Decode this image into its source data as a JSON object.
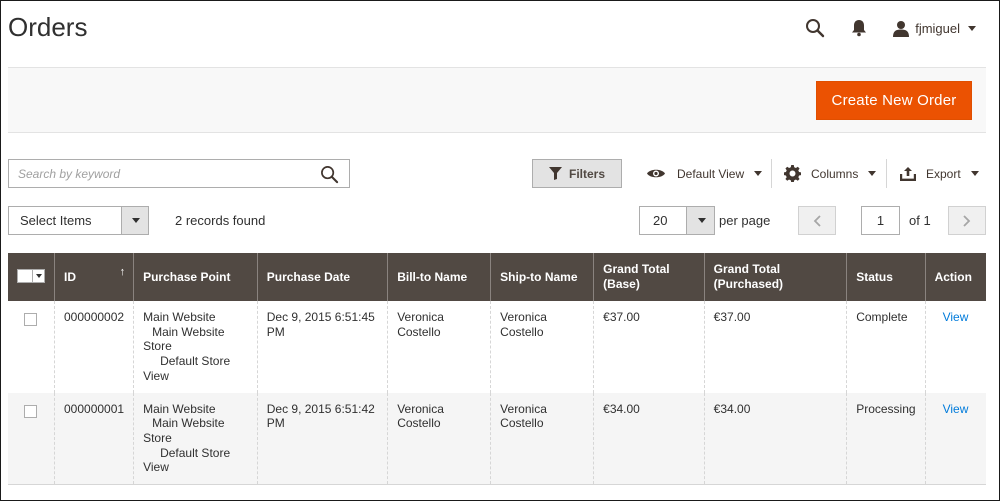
{
  "header": {
    "title": "Orders",
    "user": "fjmiguel"
  },
  "action_bar": {
    "create_label": "Create New Order"
  },
  "toolbar": {
    "search_placeholder": "Search by keyword",
    "filters_label": "Filters",
    "view_label": "Default View",
    "columns_label": "Columns",
    "export_label": "Export",
    "select_items_label": "Select Items",
    "records_found": "2 records found",
    "per_page_value": "20",
    "per_page_label": "per page",
    "current_page": "1",
    "total_pages_label": "of 1"
  },
  "table": {
    "columns": [
      "ID",
      "Purchase Point",
      "Purchase Date",
      "Bill-to Name",
      "Ship-to Name",
      "Grand Total (Base)",
      "Grand Total (Purchased)",
      "Status",
      "Action"
    ],
    "rows": [
      {
        "id": "000000002",
        "purchase_point": [
          "Main Website",
          "Main Website Store",
          "Default Store View"
        ],
        "purchase_point_lines": [
          "Main Website",
          "Main Website",
          "Store",
          "Default Store",
          "View"
        ],
        "purchase_date": "Dec 9, 2015 6:51:45 PM",
        "bill_to": "Veronica Costello",
        "ship_to": "Veronica Costello",
        "total_base": "€37.00",
        "total_purchased": "€37.00",
        "status": "Complete",
        "action": "View"
      },
      {
        "id": "000000001",
        "purchase_point": [
          "Main Website",
          "Main Website Store",
          "Default Store View"
        ],
        "purchase_point_lines": [
          "Main Website",
          "Main Website",
          "Store",
          "Default Store",
          "View"
        ],
        "purchase_date": "Dec 9, 2015 6:51:42 PM",
        "bill_to": "Veronica Costello",
        "ship_to": "Veronica Costello",
        "total_base": "€34.00",
        "total_purchased": "€34.00",
        "status": "Processing",
        "action": "View"
      }
    ]
  },
  "colors": {
    "accent": "#eb5202",
    "table_header": "#514943",
    "link": "#007bdb"
  },
  "icons": [
    "search-icon",
    "bell-icon",
    "user-icon",
    "filter-icon",
    "eye-icon",
    "gear-icon",
    "export-icon",
    "chevron-left-icon",
    "chevron-right-icon",
    "sort-up-icon"
  ]
}
